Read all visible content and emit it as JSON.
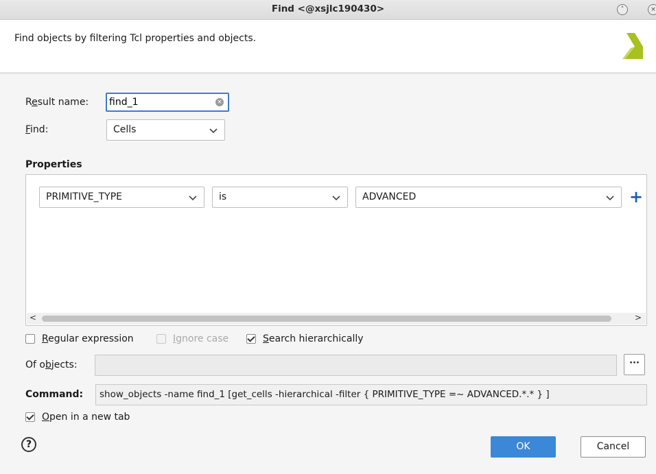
{
  "window": {
    "title": "Find <@xsjlc190430>",
    "buttons": {
      "minimize_glyph": "˄",
      "close_glyph": "×"
    }
  },
  "header": {
    "description": "Find objects by filtering Tcl properties and objects.",
    "logo_icon": "xilinx-logo-icon",
    "logo_color": "#a8c020"
  },
  "form": {
    "result_name": {
      "label_pre": "R",
      "label_u": "e",
      "label_post": "sult name:",
      "value": "find_1"
    },
    "find": {
      "label_u": "F",
      "label_post": "ind:",
      "value": "Cells"
    }
  },
  "properties": {
    "title": "Properties",
    "rows": [
      {
        "property": "PRIMITIVE_TYPE",
        "operator": "is",
        "value": "ADVANCED"
      }
    ],
    "add_glyph": "+",
    "scroll_left": "<",
    "scroll_right": ">"
  },
  "options": {
    "regex": {
      "label_u": "R",
      "label_post": "egular expression",
      "checked": false
    },
    "ignore_case": {
      "label_u": "I",
      "label_post": "gnore case",
      "checked": false,
      "enabled": false
    },
    "hierarchical": {
      "label_u": "S",
      "label_post": "earch hierarchically",
      "checked": true
    }
  },
  "of_objects": {
    "label_pre": "Of o",
    "label_u": "b",
    "label_post": "jects:",
    "value": "",
    "browse_label": "···"
  },
  "command": {
    "label": "Command:",
    "text": "show_objects -name find_1 [get_cells -hierarchical -filter { PRIMITIVE_TYPE =~ ADVANCED.*.* } ]"
  },
  "open_new_tab": {
    "label_u": "O",
    "label_post": "pen in a new tab",
    "checked": true
  },
  "footer": {
    "help_glyph": "?",
    "ok_label": "OK",
    "cancel_label": "Cancel",
    "ok_color": "#3b87d8"
  }
}
